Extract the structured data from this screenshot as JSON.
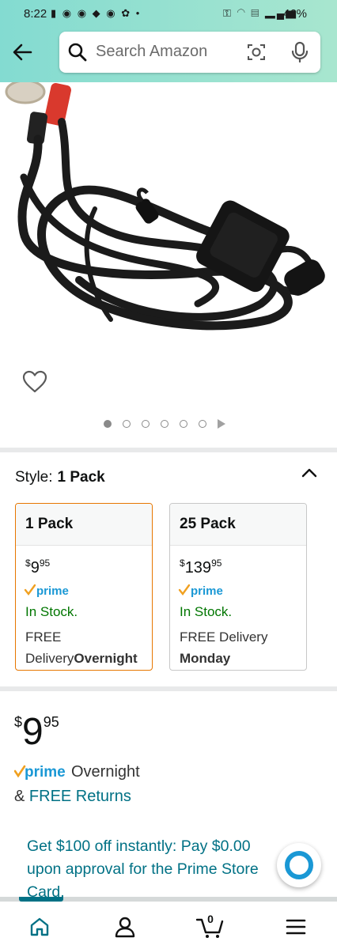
{
  "status_bar": {
    "time": "8:22",
    "battery": "46%"
  },
  "search": {
    "placeholder": "Search Amazon"
  },
  "product": {
    "image_count": 6,
    "active_image": 1
  },
  "style": {
    "label": "Style:",
    "selected": "1 Pack",
    "options": [
      {
        "name": "1 Pack",
        "price_currency": "$",
        "price_whole": "9",
        "price_cents": "95",
        "prime": "prime",
        "stock": "In Stock.",
        "delivery_prefix": "FREE DeliveryOvernight"
      },
      {
        "name": "25 Pack",
        "price_currency": "$",
        "price_whole": "139",
        "price_cents": "95",
        "prime": "prime",
        "stock": "In Stock.",
        "delivery_line1": "FREE Delivery",
        "delivery_line2": "Monday"
      }
    ]
  },
  "buybox": {
    "currency": "$",
    "price_whole": "9",
    "price_cents": "95",
    "prime": "prime",
    "shipping": "Overnight",
    "returns_prefix": "&",
    "returns_link": "FREE Returns",
    "card_offer": "Get $100 off instantly: Pay $0.00 upon approval for the Prime Store Card."
  },
  "nav": {
    "cart_count": "0"
  },
  "colors": {
    "header_gradient_start": "#83dbd1",
    "header_gradient_end": "#a8e6cf",
    "link": "#007185",
    "in_stock": "#007600",
    "selected_border": "#e77600"
  }
}
